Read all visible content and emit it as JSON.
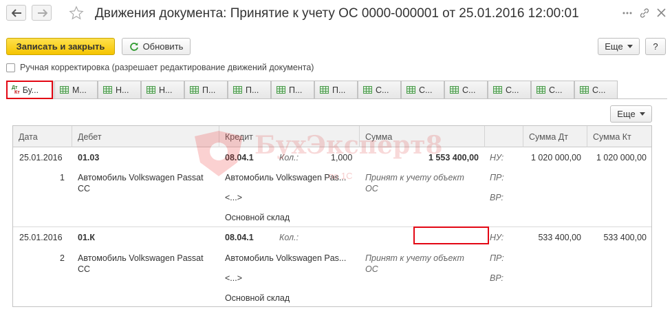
{
  "window": {
    "title": "Движения документа: Принятие к учету ОС 0000-000001 от 25.01.2016 12:00:01",
    "more_icon": "ellipsis-icon",
    "link_icon": "link-icon",
    "close_icon": "close-icon"
  },
  "toolbar": {
    "save_close": "Записать и закрыть",
    "refresh": "Обновить",
    "more": "Еще",
    "help": "?"
  },
  "manual_edit": {
    "label": "Ручная корректировка (разрешает редактирование движений документа)",
    "checked": false
  },
  "tabs": [
    {
      "label": "Бу...",
      "icon": "dt-kt-icon",
      "active": true
    },
    {
      "label": "М...",
      "icon": "table-icon"
    },
    {
      "label": "Н...",
      "icon": "table-icon"
    },
    {
      "label": "Н...",
      "icon": "table-icon"
    },
    {
      "label": "П...",
      "icon": "table-icon"
    },
    {
      "label": "П...",
      "icon": "table-icon"
    },
    {
      "label": "П...",
      "icon": "table-icon"
    },
    {
      "label": "П...",
      "icon": "table-icon"
    },
    {
      "label": "С...",
      "icon": "table-icon"
    },
    {
      "label": "С...",
      "icon": "table-icon"
    },
    {
      "label": "С...",
      "icon": "table-icon"
    },
    {
      "label": "С...",
      "icon": "table-icon"
    },
    {
      "label": "С...",
      "icon": "table-icon"
    },
    {
      "label": "С...",
      "icon": "table-icon"
    }
  ],
  "grid": {
    "more": "Еще",
    "columns": [
      "Дата",
      "Дебет",
      "Кредит",
      "Сумма",
      "",
      "Сумма Дт",
      "Сумма Кт"
    ],
    "rows": [
      {
        "date": "25.01.2016",
        "num": "1",
        "debit_account": "01.03",
        "debit_sub": "Автомобиль Volkswagen Passat",
        "debit_sub2": "CC",
        "credit_account": "08.04.1",
        "credit_sub1": "Автомобиль Volkswagen Pas...",
        "credit_sub2": "<...>",
        "credit_sub3": "Основной склад",
        "qty_label": "Кол.:",
        "qty": "1,000",
        "amount": "1 553 400,00",
        "content1": "Принят к учету объект",
        "content2": "ОС",
        "nu": "НУ:",
        "pr": "ПР:",
        "vr": "ВР:",
        "sum_dt": "1 020 000,00",
        "sum_kt": "1 020 000,00"
      },
      {
        "date": "25.01.2016",
        "num": "2",
        "debit_account": "01.К",
        "debit_sub": "Автомобиль Volkswagen Passat",
        "debit_sub2": "CC",
        "credit_account": "08.04.1",
        "credit_sub1": "Автомобиль Volkswagen Pas...",
        "credit_sub2": "<...>",
        "credit_sub3": "Основной склад",
        "qty_label": "Кол.:",
        "qty": "",
        "amount": "",
        "content1": "Принят к учету объект",
        "content2": "ОС",
        "nu": "НУ:",
        "pr": "ПР:",
        "vr": "ВР:",
        "sum_dt": "533 400,00",
        "sum_kt": "533 400,00"
      }
    ]
  },
  "watermark": {
    "text": "БухЭксперт8",
    "sub": "по 1С"
  }
}
